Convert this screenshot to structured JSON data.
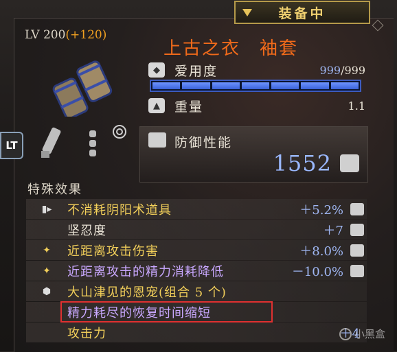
{
  "status_tag": "装备中",
  "item": {
    "level_label": "LV 200",
    "level_bonus": "(+120)",
    "name": "上古之衣　袖套"
  },
  "stats": {
    "durability": {
      "label": "爱用度",
      "current": "999",
      "max": "/999",
      "fill_fraction": 1.0
    },
    "weight": {
      "label": "重量",
      "value": "1.1"
    }
  },
  "controller_badge": "LT",
  "defense": {
    "label": "防御性能",
    "value": "1552"
  },
  "special_effects": {
    "title": "特殊效果",
    "rows": [
      {
        "label": "不消耗阴阳术道具",
        "value": "＋5.2%",
        "color": "gold",
        "icon": "talisman-icon",
        "end_icon": true
      },
      {
        "label": "坚忍度",
        "value": "＋7",
        "color": "white",
        "icon": "",
        "end_icon": true
      },
      {
        "label": "近距离攻击伤害",
        "value": "＋8.0%",
        "color": "gold",
        "icon": "star-icon",
        "end_icon": true
      },
      {
        "label": "近距离攻击的精力消耗降低",
        "value": "－10.0%",
        "color": "purple",
        "icon": "star-icon",
        "end_icon": true
      },
      {
        "label": "大山津见的恩宠(组合 5 个)",
        "value": "",
        "color": "gold",
        "icon": "set-bonus-icon",
        "end_icon": false
      },
      {
        "label": "精力耗尽的恢复时间缩短",
        "value": "",
        "color": "purple",
        "icon": "",
        "end_icon": false
      },
      {
        "label": "攻击力",
        "value": "＋4",
        "color": "gold",
        "icon": "",
        "end_icon": false
      }
    ]
  },
  "watermark": "小黑盒",
  "colors": {
    "item_name": "#f06a1a",
    "level_bonus": "#f0a020",
    "highlight": "#e03030",
    "durability_bar": "#3a62d8"
  }
}
